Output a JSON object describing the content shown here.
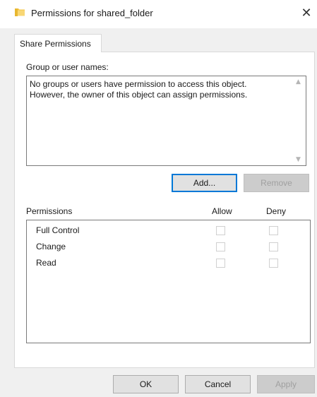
{
  "window": {
    "title": "Permissions for shared_folder",
    "close_glyph": "✕",
    "icon": "folder-icon"
  },
  "tabs": [
    {
      "label": "Share Permissions",
      "selected": true
    }
  ],
  "group_section": {
    "label": "Group or user names:",
    "message_lines": [
      "No groups or users have permission to access this object.",
      "However, the owner of this object can assign permissions."
    ],
    "scroll_up_glyph": "▲",
    "scroll_down_glyph": "▼"
  },
  "buttons": {
    "add": "Add...",
    "remove": "Remove",
    "ok": "OK",
    "cancel": "Cancel",
    "apply": "Apply"
  },
  "permissions": {
    "header": "Permissions",
    "allow_header": "Allow",
    "deny_header": "Deny",
    "rows": [
      {
        "name": "Full Control",
        "allow": false,
        "deny": false
      },
      {
        "name": "Change",
        "allow": false,
        "deny": false
      },
      {
        "name": "Read",
        "allow": false,
        "deny": false
      }
    ]
  },
  "colors": {
    "focus_border": "#0078d7",
    "folder_yellow": "#f4c542"
  }
}
